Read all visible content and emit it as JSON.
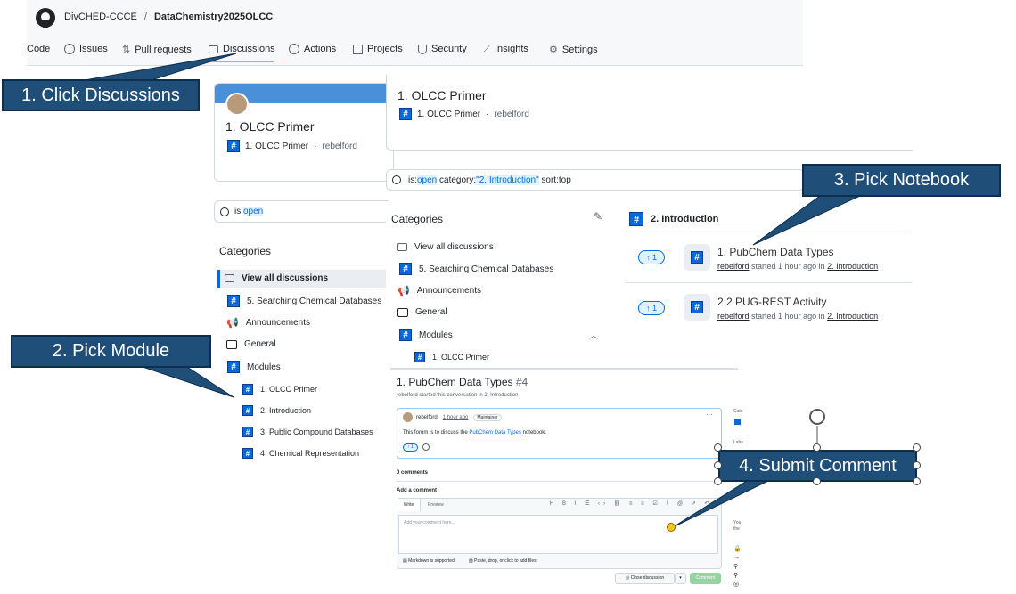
{
  "header": {
    "org": "DivCHED-CCCE",
    "separator": "/",
    "repo": "DataChemistry2025OLCC"
  },
  "nav": {
    "code": "Code",
    "issues": "Issues",
    "pulls": "Pull requests",
    "discussions": "Discussions",
    "actions": "Actions",
    "projects": "Projects",
    "security": "Security",
    "insights": "Insights",
    "settings": "Settings"
  },
  "callouts": {
    "c1": "1. Click Discussions",
    "c2": "2. Pick Module",
    "c3": "3. Pick Notebook",
    "c4": "4. Submit Comment"
  },
  "primer": {
    "title": "1. OLCC Primer",
    "sub": "1. OLCC Primer",
    "dot": "·",
    "user": "rebelford"
  },
  "left": {
    "search": "is:",
    "search_val": "open",
    "categories": "Categories",
    "items": [
      "View all discussions",
      "5. Searching Chemical Databases",
      "Announcements",
      "General",
      "Modules"
    ],
    "modules": [
      "1. OLCC Primer",
      "2. Introduction",
      "3. Public Compound Databases",
      "4. Chemical Representation"
    ]
  },
  "middle": {
    "search_prefix": "is:",
    "search_open": "open",
    "search_cat": " category:",
    "search_cat_val": "\"2. Introduction\"",
    "search_sort": " sort:top",
    "categories": "Categories",
    "items": [
      "View all discussions",
      "5. Searching Chemical Databases",
      "Announcements",
      "General",
      "Modules"
    ],
    "modules": [
      "1. OLCC Primer"
    ]
  },
  "right": {
    "heading": "2. Introduction",
    "items": [
      {
        "title": "1. PubChem Data Types",
        "user": "rebelford",
        "meta": " started 1 hour ago in ",
        "cat": "2. Introduction",
        "votes": "1"
      },
      {
        "title": "2.2 PUG-REST Activity",
        "user": "rebelford",
        "meta": " started 1 hour ago in ",
        "cat": "2. Introduction",
        "votes": "1"
      }
    ]
  },
  "discussion": {
    "title": "1. PubChem Data Types",
    "num": "#4",
    "byline_user": "rebelford",
    "byline_rest": " started this conversation in ",
    "byline_cat": "2. Introduction",
    "author": "rebelford",
    "time": "1 hour ago",
    "badge": "Maintainer",
    "body_pre": "This forum is to discuss the ",
    "body_link": "PubChem Data Types",
    "body_post": " notebook.",
    "votes": "1",
    "comments": "0 comments",
    "add": "Add a comment",
    "tab_write": "Write",
    "tab_preview": "Preview",
    "placeholder": "Add your comment here...",
    "markdown": "Markdown is supported",
    "files": "Paste, drop, or click to add files",
    "close": "Close discussion",
    "comment": "Comment",
    "side_cat": "Cate",
    "side_label": "Labe",
    "side_you1": "You",
    "side_you2": "the"
  }
}
